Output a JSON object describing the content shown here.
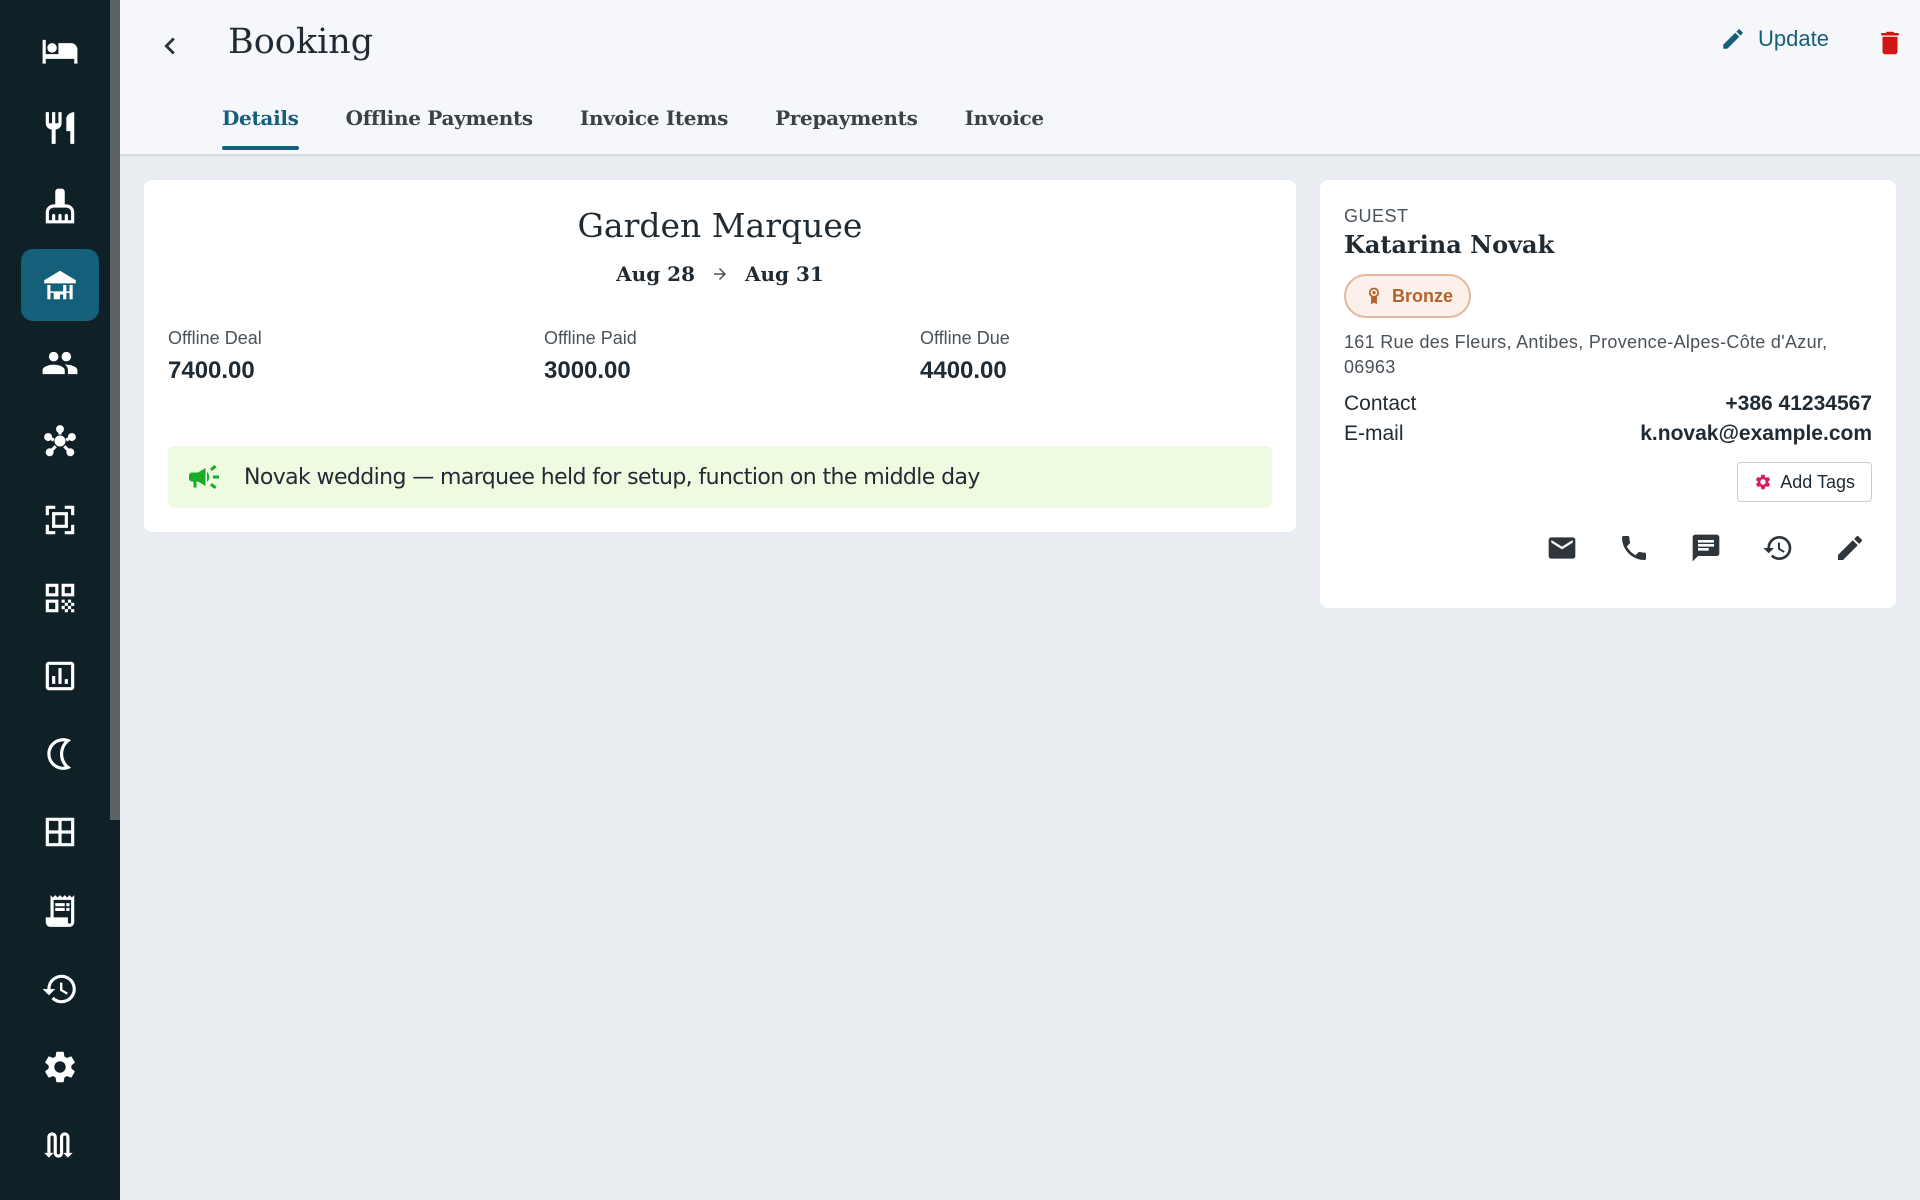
{
  "sidebar": {
    "items": [
      {
        "icon": "bed-icon"
      },
      {
        "icon": "restaurant-icon"
      },
      {
        "icon": "cleaning-icon"
      },
      {
        "icon": "venue-icon",
        "active": true
      },
      {
        "icon": "people-icon"
      },
      {
        "icon": "hub-icon"
      },
      {
        "icon": "scan-icon"
      },
      {
        "icon": "qr-code-icon"
      },
      {
        "icon": "analytics-icon"
      },
      {
        "icon": "night-audit-icon"
      },
      {
        "icon": "floor-plan-icon"
      },
      {
        "icon": "receipt-icon"
      },
      {
        "icon": "history-icon"
      },
      {
        "icon": "settings-icon"
      },
      {
        "icon": "swap-icon"
      }
    ]
  },
  "header": {
    "title": "Booking",
    "update_label": "Update",
    "tabs": [
      {
        "label": "Details",
        "active": true
      },
      {
        "label": "Offline Payments"
      },
      {
        "label": "Invoice Items"
      },
      {
        "label": "Prepayments"
      },
      {
        "label": "Invoice"
      }
    ]
  },
  "booking": {
    "venue": "Garden Marquee",
    "date_from": "Aug 28",
    "date_to": "Aug 31",
    "stats": [
      {
        "label": "Offline Deal",
        "value": "7400.00"
      },
      {
        "label": "Offline Paid",
        "value": "3000.00"
      },
      {
        "label": "Offline Due",
        "value": "4400.00"
      }
    ],
    "note": "Novak wedding — marquee held for setup, function on the middle day"
  },
  "guest": {
    "section_label": "GUEST",
    "name": "Katarina Novak",
    "tier": "Bronze",
    "address": "161 Rue des Fleurs, Antibes, Provence-Alpes-Côte d'Azur, 06963",
    "contact_label": "Contact",
    "contact_value": "+386 41234567",
    "email_label": "E-mail",
    "email_value": "k.novak@example.com",
    "add_tags_label": "Add Tags"
  },
  "colors": {
    "sidebar_bg": "#0f2027",
    "accent": "#145f7a",
    "delete": "#d01515",
    "note_bg": "#eefbe0",
    "tier": "#b5632d"
  }
}
